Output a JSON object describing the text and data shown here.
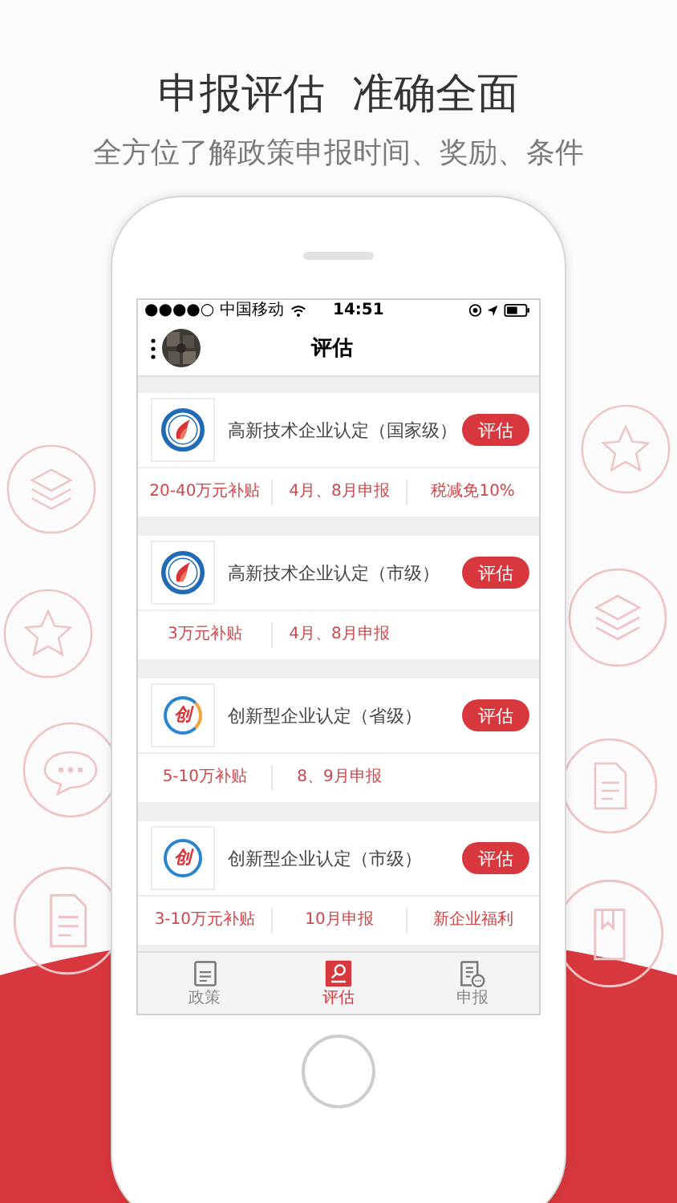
{
  "headline": "申报评估  准确全面",
  "subtitle": "全方位了解政策申报时间、奖励、条件",
  "status_bar": {
    "carrier": "●●●●○ 中国移动",
    "time": "14:51"
  },
  "nav": {
    "title": "评估"
  },
  "items": [
    {
      "title": "高新技术企业认定（国家级）",
      "button": "评估",
      "logo": {
        "kind": "flame"
      },
      "facts": [
        "20-40万元补贴",
        "4月、8月申报",
        "税减免10%"
      ]
    },
    {
      "title": "高新技术企业认定（市级）",
      "button": "评估",
      "logo": {
        "kind": "flame"
      },
      "facts": [
        "3万元补贴",
        "4月、8月申报"
      ]
    },
    {
      "title": "创新型企业认定（省级）",
      "button": "评估",
      "logo": {
        "kind": "swoosh",
        "text": "创"
      },
      "facts": [
        "5-10万补贴",
        "8、9月申报"
      ]
    },
    {
      "title": "创新型企业认定（市级）",
      "button": "评估",
      "logo": {
        "kind": "ring",
        "text": "创"
      },
      "facts": [
        "3-10万元补贴",
        "10月申报",
        "新企业福利"
      ]
    }
  ],
  "tabs": [
    {
      "label": "政策",
      "kind": "news",
      "selected": false
    },
    {
      "label": "评估",
      "kind": "search",
      "selected": true
    },
    {
      "label": "申报",
      "kind": "form",
      "selected": false
    }
  ]
}
